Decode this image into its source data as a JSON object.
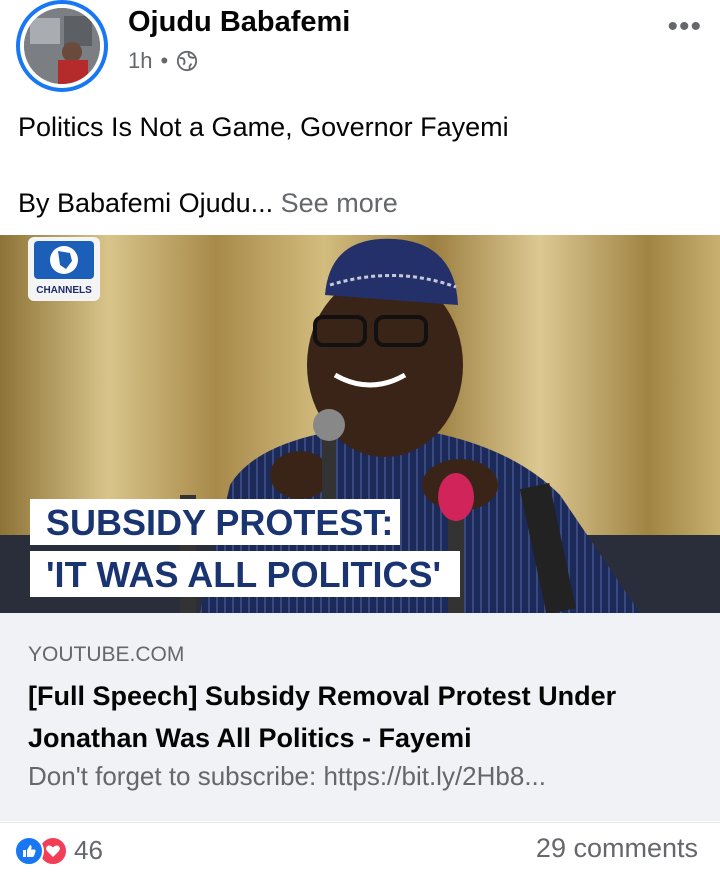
{
  "post": {
    "author": "Ojudu Babafemi",
    "time": "1h",
    "separator": "•",
    "more_label": "•••",
    "text_line1": "Politics Is Not a Game, Governor Fayemi",
    "text_line2": "By Babafemi Ojudu...",
    "see_more": "See more"
  },
  "media": {
    "channel_logo_text": "CHANNELS",
    "caption_line1": "SUBSIDY PROTEST:",
    "caption_line2": "'IT WAS ALL POLITICS'"
  },
  "link": {
    "domain": "YOUTUBE.COM",
    "title": "[Full Speech] Subsidy Removal Protest Under Jonathan Was All Politics - Fayemi",
    "description": "Don't forget to subscribe: https://bit.ly/2Hb8..."
  },
  "footer": {
    "reaction_count": "46",
    "comments": "29 comments"
  },
  "colors": {
    "accent": "#1877f2",
    "love": "#f33e58",
    "secondary_text": "#65676b"
  }
}
